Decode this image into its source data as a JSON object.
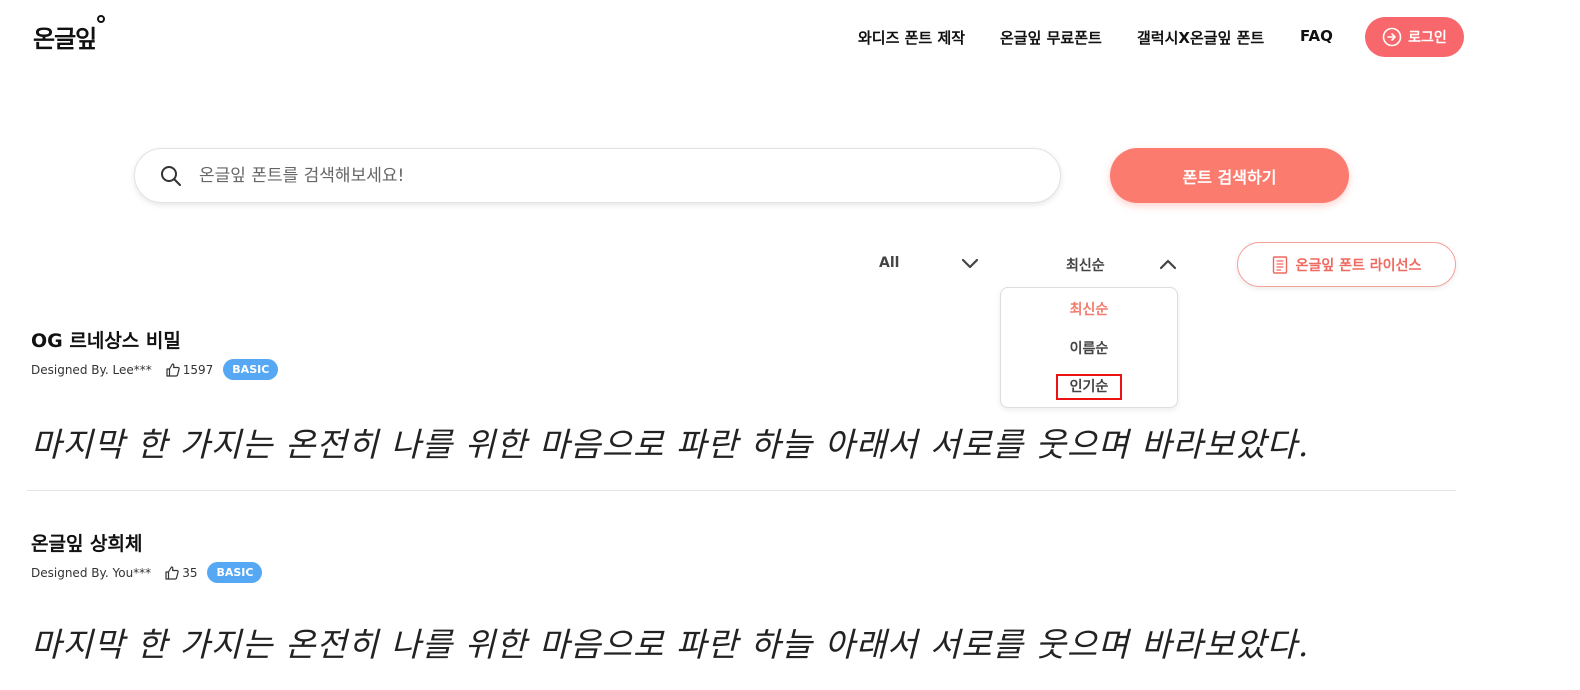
{
  "header": {
    "logo": "온글잎",
    "nav": [
      {
        "label": "와디즈 폰트 제작"
      },
      {
        "label": "온글잎 무료폰트"
      },
      {
        "label": "갤럭시X온글잎 폰트"
      },
      {
        "label": "FAQ"
      }
    ],
    "login_label": "로그인"
  },
  "search": {
    "placeholder": "온글잎 폰트를 검색해보세요!",
    "button_label": "폰트 검색하기"
  },
  "filters": {
    "category": "All",
    "sort": "최신순",
    "license_label": "온글잎 폰트 라이선스"
  },
  "sort_dropdown": {
    "options": [
      "최신순",
      "이름순",
      "인기순"
    ],
    "active_index": 0,
    "highlighted_index": 2
  },
  "fonts": [
    {
      "name": "OG 르네상스 비밀",
      "designer": "Designed By. Lee***",
      "likes": "1597",
      "badge": "BASIC",
      "preview": "마지막 한 가지는 온전히 나를 위한 마음으로 파란 하늘 아래서 서로를 웃으며 바라보았다."
    },
    {
      "name": "온글잎 상희체",
      "designer": "Designed By. You***",
      "likes": "35",
      "badge": "BASIC",
      "preview": "마지막 한 가지는 온전히 나를 위한 마음으로 파란 하늘 아래서 서로를 웃으며 바라보았다."
    }
  ],
  "colors": {
    "accent": "#f7676b",
    "search_button": "#fb7b6f",
    "badge": "#56a8f5"
  }
}
